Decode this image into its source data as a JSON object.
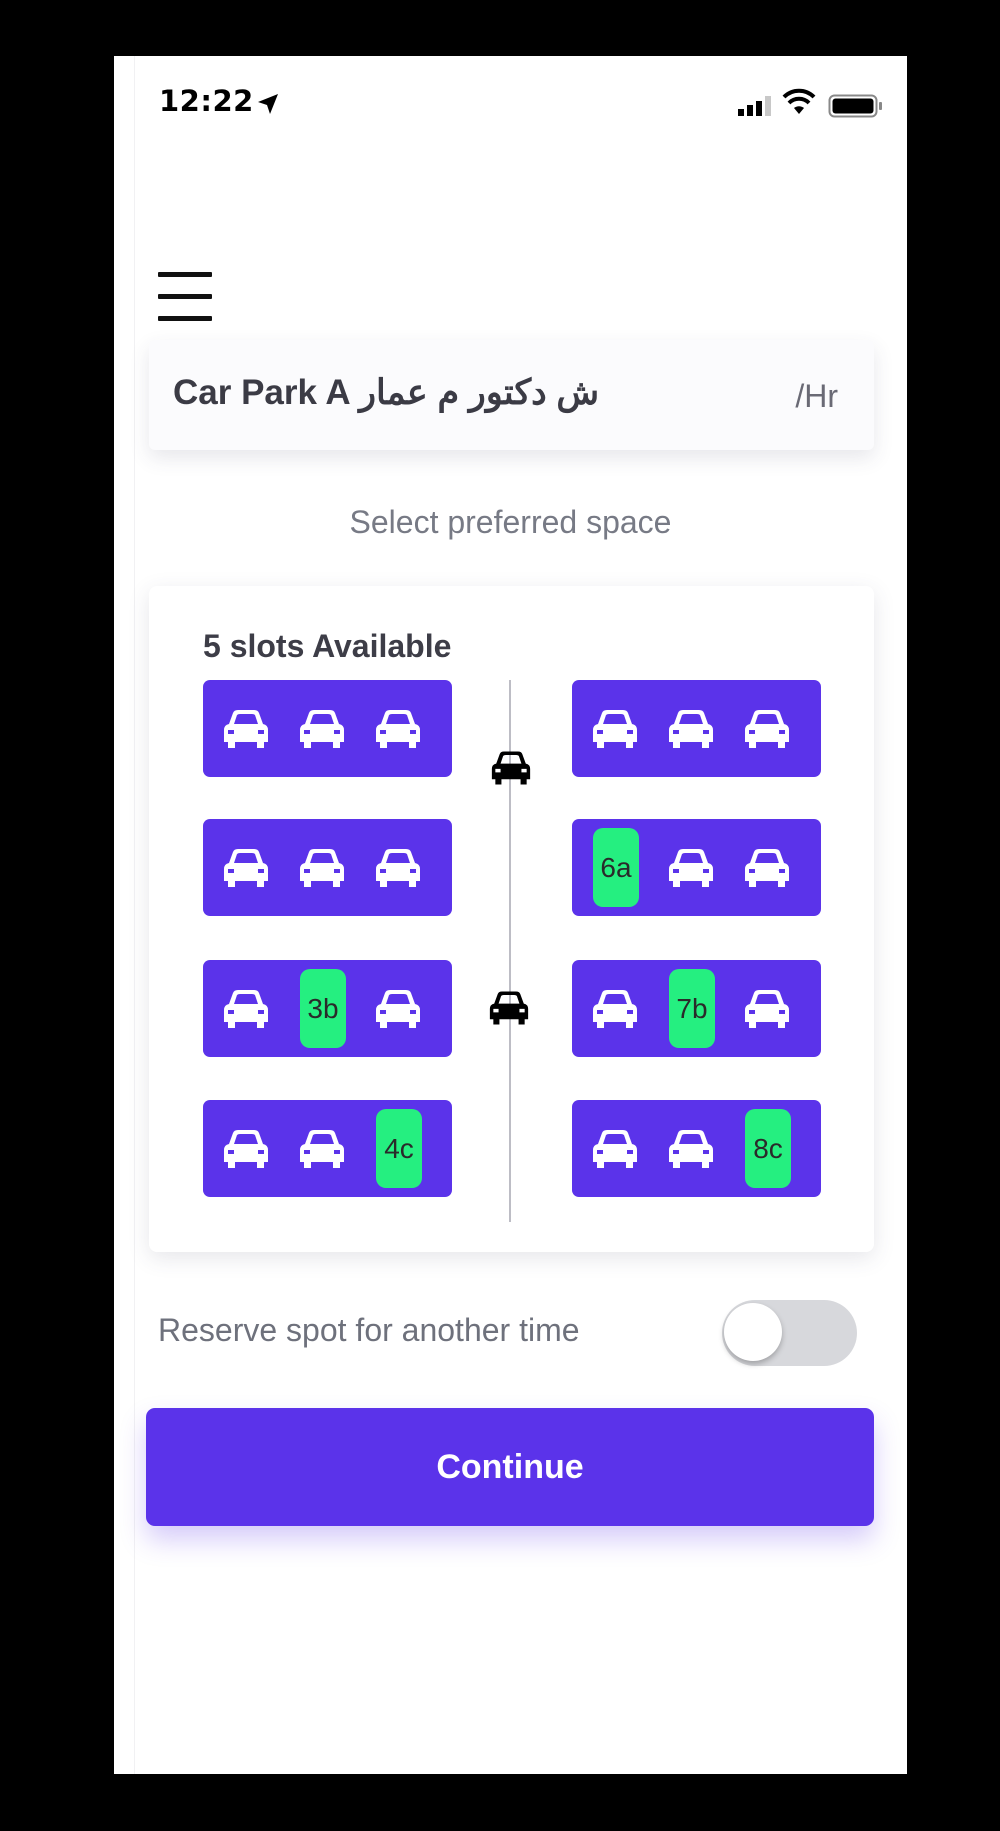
{
  "status_bar": {
    "time": "12:22",
    "icons": [
      "location-arrow-icon",
      "signal-icon",
      "wifi-icon",
      "battery-icon"
    ]
  },
  "header": {
    "menu_icon": "hamburger-menu-icon"
  },
  "car_park": {
    "name": "Car Park A ش دكتور م عمار",
    "rate": "/Hr"
  },
  "select_hint": "Select preferred space",
  "lot": {
    "slots_label": "5 slots Available",
    "lane_icon": "car-icon",
    "available_color": "#25ef80",
    "row_color": "#5b33ea",
    "left_rows": [
      [
        "occupied",
        "occupied",
        "occupied"
      ],
      [
        "occupied",
        "occupied",
        "occupied"
      ],
      [
        "occupied",
        "3b",
        "occupied"
      ],
      [
        "occupied",
        "occupied",
        "4c"
      ]
    ],
    "right_rows": [
      [
        "occupied",
        "occupied",
        "occupied"
      ],
      [
        "6a",
        "occupied",
        "occupied"
      ],
      [
        "occupied",
        "7b",
        "occupied"
      ],
      [
        "occupied",
        "occupied",
        "8c"
      ]
    ]
  },
  "reserve": {
    "label": "Reserve spot for another time",
    "enabled": false
  },
  "continue_label": "Continue",
  "accent_color": "#5b33ea"
}
